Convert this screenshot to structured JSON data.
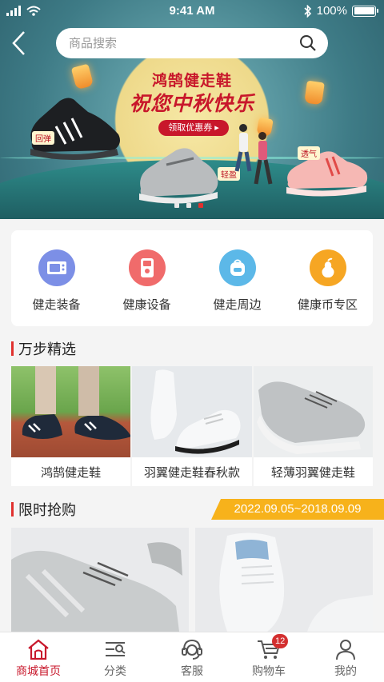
{
  "status_bar": {
    "time": "9:41 AM",
    "battery": "100%"
  },
  "search": {
    "placeholder": "商品搜索"
  },
  "banner": {
    "title": "鸿鹄健走鞋",
    "slogan": "祝您中秋快乐",
    "coupon_button": "领取优惠券 ▸",
    "tags": [
      "回弹",
      "轻盈",
      "透气"
    ],
    "slide_count": 3,
    "active_slide": 3
  },
  "categories": [
    {
      "label": "健走装备",
      "icon": "microwave-icon",
      "color": "#7c8fe6"
    },
    {
      "label": "健康设备",
      "icon": "glucose-meter-icon",
      "color": "#f06b6b"
    },
    {
      "label": "健走周边",
      "icon": "backpack-icon",
      "color": "#5cb8e8"
    },
    {
      "label": "健康币专区",
      "icon": "pear-icon",
      "color": "#f6a623"
    }
  ],
  "section_wanbu": {
    "title": "万步精选"
  },
  "products": [
    {
      "name": "鸿鹄健走鞋"
    },
    {
      "name": "羽翼健走鞋春秋款"
    },
    {
      "name": "轻薄羽翼健走鞋"
    }
  ],
  "section_flash": {
    "title": "限时抢购",
    "date_range": "2022.09.05~2018.09.09"
  },
  "tabbar": [
    {
      "label": "商城首页",
      "icon": "home-icon",
      "active": true
    },
    {
      "label": "分类",
      "icon": "category-icon"
    },
    {
      "label": "客服",
      "icon": "headset-icon"
    },
    {
      "label": "购物车",
      "icon": "cart-icon",
      "badge": "12"
    },
    {
      "label": "我的",
      "icon": "user-icon"
    }
  ],
  "colors": {
    "accent": "#c8172b",
    "date_badge": "#f7b21b"
  }
}
